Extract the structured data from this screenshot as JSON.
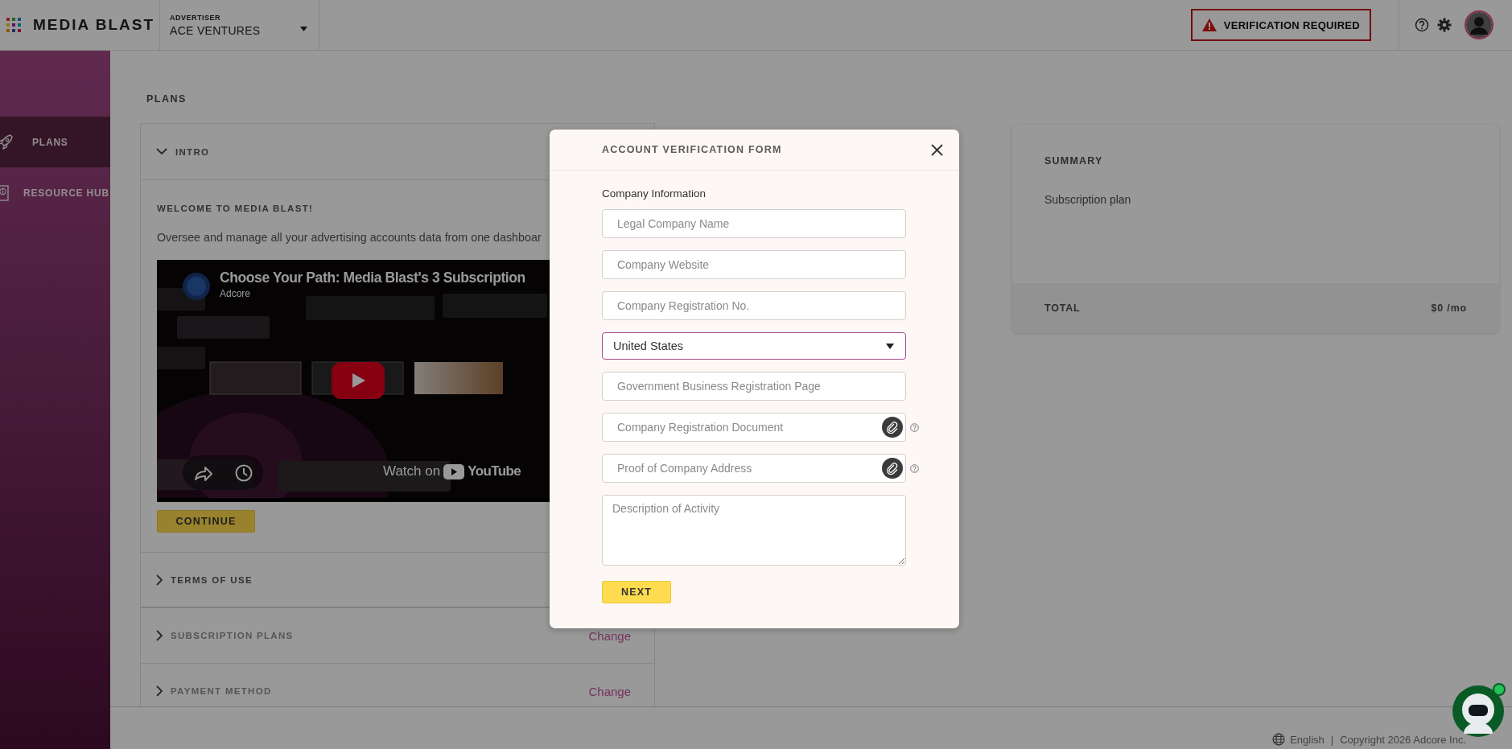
{
  "header": {
    "brand": "MEDIA BLAST",
    "advertiser": {
      "label": "ADVERTISER",
      "value": "ACE VENTURES"
    },
    "verification_button": "VERIFICATION REQUIRED"
  },
  "sidebar": {
    "items": [
      {
        "label": "PLANS",
        "selected": true
      },
      {
        "label": "RESOURCE HUB",
        "selected": false
      }
    ]
  },
  "page_title": "PLANS",
  "sections": [
    {
      "title": "INTRO",
      "expanded": true,
      "disabled": false,
      "heading": "WELCOME TO MEDIA BLAST!",
      "text": "Oversee and manage all your advertising accounts data from one dashboar",
      "video": {
        "title": "Choose Your Path: Media Blast's 3 Subscription",
        "channel": "Adcore",
        "watch_label": "Watch on",
        "watch_brand": "YouTube"
      },
      "button": "CONTINUE"
    },
    {
      "title": "TERMS OF USE",
      "expanded": false,
      "disabled": false
    },
    {
      "title": "SUBSCRIPTION PLANS",
      "expanded": false,
      "disabled": true,
      "action": "Change"
    },
    {
      "title": "PAYMENT METHOD",
      "expanded": false,
      "disabled": true,
      "action": "Change"
    }
  ],
  "summary": {
    "title": "SUMMARY",
    "rows": [
      "Subscription plan"
    ],
    "total_label": "TOTAL",
    "total_value": "$0 /mo"
  },
  "footer": {
    "language": "English",
    "separator": "|",
    "copyright": "Copyright 2026 Adcore Inc."
  },
  "modal": {
    "title": "ACCOUNT VERIFICATION FORM",
    "section": "Company Information",
    "fields": [
      {
        "kind": "text",
        "placeholder": "Legal Company Name",
        "help": false
      },
      {
        "kind": "text",
        "placeholder": "Company Website",
        "help": false
      },
      {
        "kind": "text",
        "placeholder": "Company Registration No.",
        "help": false
      },
      {
        "kind": "select",
        "value": "United States",
        "help": false
      },
      {
        "kind": "text",
        "placeholder": "Government Business Registration Page",
        "help": false
      },
      {
        "kind": "file",
        "placeholder": "Company Registration Document",
        "help": true
      },
      {
        "kind": "file",
        "placeholder": "Proof of Company Address",
        "help": true
      },
      {
        "kind": "textarea",
        "placeholder": "Description of Activity",
        "help": false
      }
    ],
    "button": "NEXT"
  }
}
